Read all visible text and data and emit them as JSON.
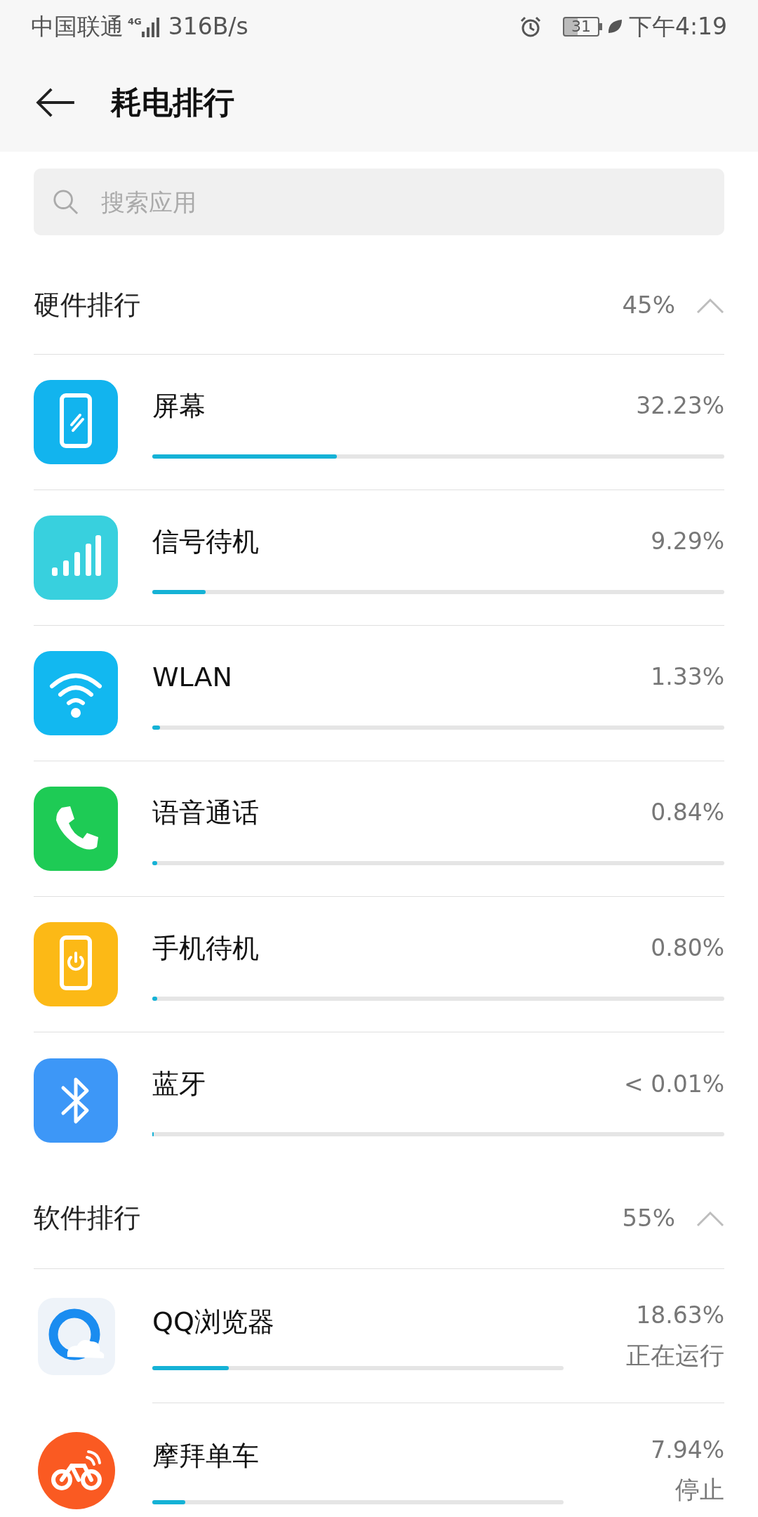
{
  "status_bar": {
    "carrier": "中国联通",
    "network": "4G",
    "speed": "316B/s",
    "battery": "31",
    "time": "下午4:19"
  },
  "header": {
    "title": "耗电排行"
  },
  "search": {
    "placeholder": "搜索应用"
  },
  "sections": [
    {
      "title": "硬件排行",
      "total": "45%",
      "expanded": true,
      "items": [
        {
          "name": "屏幕",
          "percent": "32.23%",
          "level": 0.3223,
          "color": "#12b4ee"
        },
        {
          "name": "信号待机",
          "percent": "9.29%",
          "level": 0.0929,
          "color": "#38d0de"
        },
        {
          "name": "WLAN",
          "percent": "1.33%",
          "level": 0.0133,
          "color": "#12b8f0"
        },
        {
          "name": "语音通话",
          "percent": "0.84%",
          "level": 0.0084,
          "color": "#1ecb55"
        },
        {
          "name": "手机待机",
          "percent": "0.80%",
          "level": 0.008,
          "color": "#fcb916"
        },
        {
          "name": "蓝牙",
          "percent": "< 0.01%",
          "level": 0.001,
          "color": "#3d97f7"
        }
      ]
    },
    {
      "title": "软件排行",
      "total": "55%",
      "expanded": true,
      "items": [
        {
          "name": "QQ浏览器",
          "percent": "18.63%",
          "level": 0.1863,
          "status": "正在运行"
        },
        {
          "name": "摩拜单车",
          "percent": "7.94%",
          "level": 0.0794,
          "status": "停止"
        }
      ]
    }
  ]
}
